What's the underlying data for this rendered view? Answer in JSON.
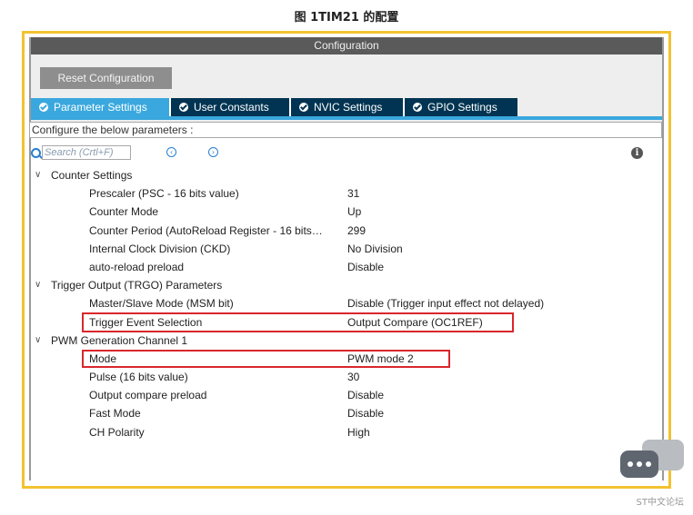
{
  "caption": "图 1TIM21 的配置",
  "window": {
    "title": "Configuration"
  },
  "toolbar": {
    "reset_label": "Reset Configuration"
  },
  "tabs": [
    {
      "label": "Parameter Settings",
      "active": true
    },
    {
      "label": "User Constants",
      "active": false
    },
    {
      "label": "NVIC Settings",
      "active": false
    },
    {
      "label": "GPIO Settings",
      "active": false
    }
  ],
  "configure_text": "Configure the below parameters :",
  "search": {
    "placeholder": "Search (Crtl+F)"
  },
  "groups": [
    {
      "label": "Counter Settings",
      "params": [
        {
          "name": "Prescaler (PSC - 16 bits value)",
          "value": "31"
        },
        {
          "name": "Counter Mode",
          "value": "Up"
        },
        {
          "name": "Counter Period (AutoReload Register - 16 bits…",
          "value": "299"
        },
        {
          "name": "Internal Clock Division (CKD)",
          "value": "No Division"
        },
        {
          "name": "auto-reload preload",
          "value": "Disable"
        }
      ]
    },
    {
      "label": "Trigger Output (TRGO) Parameters",
      "params": [
        {
          "name": "Master/Slave Mode (MSM bit)",
          "value": "Disable (Trigger input effect not delayed)"
        },
        {
          "name": "Trigger Event Selection",
          "value": "Output Compare (OC1REF)"
        }
      ]
    },
    {
      "label": "PWM Generation Channel 1",
      "params": [
        {
          "name": "Mode",
          "value": "PWM mode 2"
        },
        {
          "name": "Pulse (16 bits value)",
          "value": "30"
        },
        {
          "name": "Output compare preload",
          "value": "Disable"
        },
        {
          "name": "Fast Mode",
          "value": "Disable"
        },
        {
          "name": "CH Polarity",
          "value": "High"
        }
      ]
    }
  ],
  "watermark": "ST中文论坛",
  "colors": {
    "highlight": "#d9262c",
    "frame": "#f2c230",
    "tab_active": "#3aa8de",
    "tab_inactive": "#003452"
  }
}
